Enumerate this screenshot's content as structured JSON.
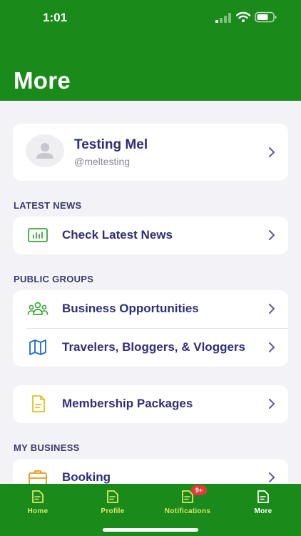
{
  "status_bar": {
    "time": "1:01"
  },
  "header": {
    "title": "More"
  },
  "profile": {
    "name": "Testing Mel",
    "handle": "@meltesting"
  },
  "sections": {
    "latest_news": {
      "label": "LATEST NEWS",
      "items": [
        {
          "label": "Check Latest News",
          "icon": "news-chart-icon"
        }
      ]
    },
    "public_groups": {
      "label": "PUBLIC GROUPS",
      "items": [
        {
          "label": "Business Opportunities",
          "icon": "group-people-icon"
        },
        {
          "label": "Travelers, Bloggers, & Vloggers",
          "icon": "map-icon"
        }
      ]
    },
    "membership": {
      "items": [
        {
          "label": "Membership Packages",
          "icon": "document-icon"
        }
      ]
    },
    "my_business": {
      "label": "MY BUSINESS",
      "items": [
        {
          "label": "Booking",
          "icon": "briefcase-icon"
        }
      ]
    }
  },
  "tab_bar": {
    "tabs": [
      {
        "label": "Home",
        "icon": "document-icon"
      },
      {
        "label": "Profile",
        "icon": "document-icon"
      },
      {
        "label": "Notifications",
        "icon": "document-icon",
        "badge": "9+"
      },
      {
        "label": "More",
        "icon": "document-icon",
        "active": true
      }
    ]
  },
  "colors": {
    "brand_green": "#1a8a1a",
    "text_navy": "#2e2e7a",
    "tab_label": "#d8e86a",
    "badge_red": "#e53935"
  }
}
